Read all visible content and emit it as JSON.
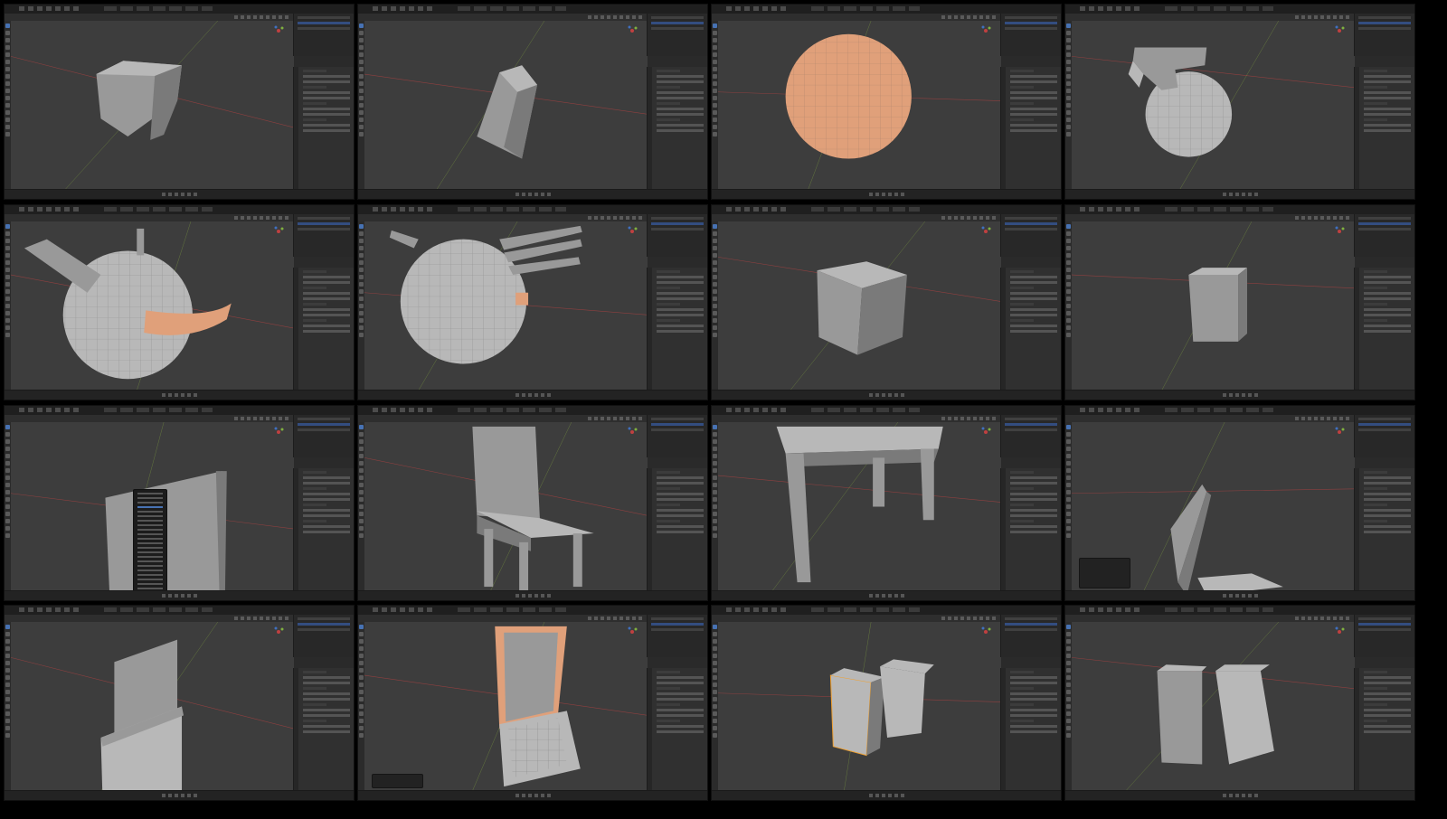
{
  "app": "Blender",
  "layout": {
    "columns": 4,
    "rows": 4
  },
  "colors": {
    "viewport": "#3d3d3d",
    "mesh_light": "#b8b8b8",
    "mesh_mid": "#999999",
    "mesh_dark": "#7a7a7a",
    "selection": "#e0a07a",
    "active_outline": "#f0a030",
    "axis_x": "#b04040",
    "axis_y": "#8ab040",
    "ui_accent": "#4772b3"
  },
  "tiles": [
    {
      "subject": "cube"
    },
    {
      "subject": "tilted-box"
    },
    {
      "subject": "selected-uv-sphere"
    },
    {
      "subject": "sphere-with-extrusion"
    },
    {
      "subject": "sphere-with-handle"
    },
    {
      "subject": "sphere-with-spikes"
    },
    {
      "subject": "cube"
    },
    {
      "subject": "small-cube"
    },
    {
      "subject": "panel-with-context-menu"
    },
    {
      "subject": "chair"
    },
    {
      "subject": "table-frame"
    },
    {
      "subject": "chair-back-closeup"
    },
    {
      "subject": "chair-back-panels"
    },
    {
      "subject": "chair-selected-back"
    },
    {
      "subject": "two-boxes-selected"
    },
    {
      "subject": "two-boxes"
    }
  ]
}
